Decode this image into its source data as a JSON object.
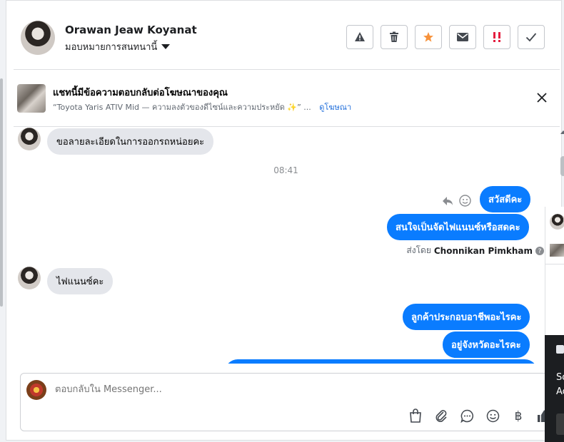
{
  "header": {
    "contact_name": "Orawan Jeaw Koyanat",
    "assign_label": "มอบหมายการสนทนานี้",
    "actions": [
      {
        "name": "warning-icon",
        "glyph": "⚠"
      },
      {
        "name": "trash-icon",
        "glyph": "🗑"
      },
      {
        "name": "star-icon",
        "glyph": "★"
      },
      {
        "name": "mail-icon",
        "glyph": "✉"
      },
      {
        "name": "urgent-icon",
        "glyph": "!!"
      },
      {
        "name": "check-icon",
        "glyph": "✓"
      }
    ]
  },
  "ad_banner": {
    "title": "แชทนี้มีข้อความตอบกลับต่อโฆษณาของคุณ",
    "description": "“Toyota Yaris ATIV Mid — ความลงตัวของดีไซน์และความประหยัด ✨” ...",
    "link_label": "ดูโฆษณา"
  },
  "thread": {
    "msg_in_1": "ขอลายละเอียดในการออกรถหน่อยคะ",
    "time": "08:41",
    "msg_out_1": "สวัสดีคะ",
    "msg_out_2": "สนใจเป็นจัดไฟแนนซ์หรือสดคะ",
    "sent_by_prefix": "ส่งโดย",
    "sent_by_name": "Chonnikan Pimkham",
    "msg_in_2": "ไฟแนนซ์คะ",
    "msg_out_3": "ลูกค้าประกอบอาชีพอะไรคะ",
    "msg_out_4": "อยู่จังหวัดอะไรคะ"
  },
  "composer": {
    "placeholder": "ตอบกลับใน Messenger...",
    "tools": [
      "shopping-bag-icon",
      "paperclip-icon",
      "chat-bubble-icon",
      "emoji-icon",
      "baht-icon",
      "thumbs-up-icon"
    ]
  },
  "side_panel": {
    "text_1": "So",
    "text_2": "Ac"
  },
  "colors": {
    "accent": "#0a7cff",
    "star": "#f7923b",
    "urgent": "#e41e3f"
  }
}
